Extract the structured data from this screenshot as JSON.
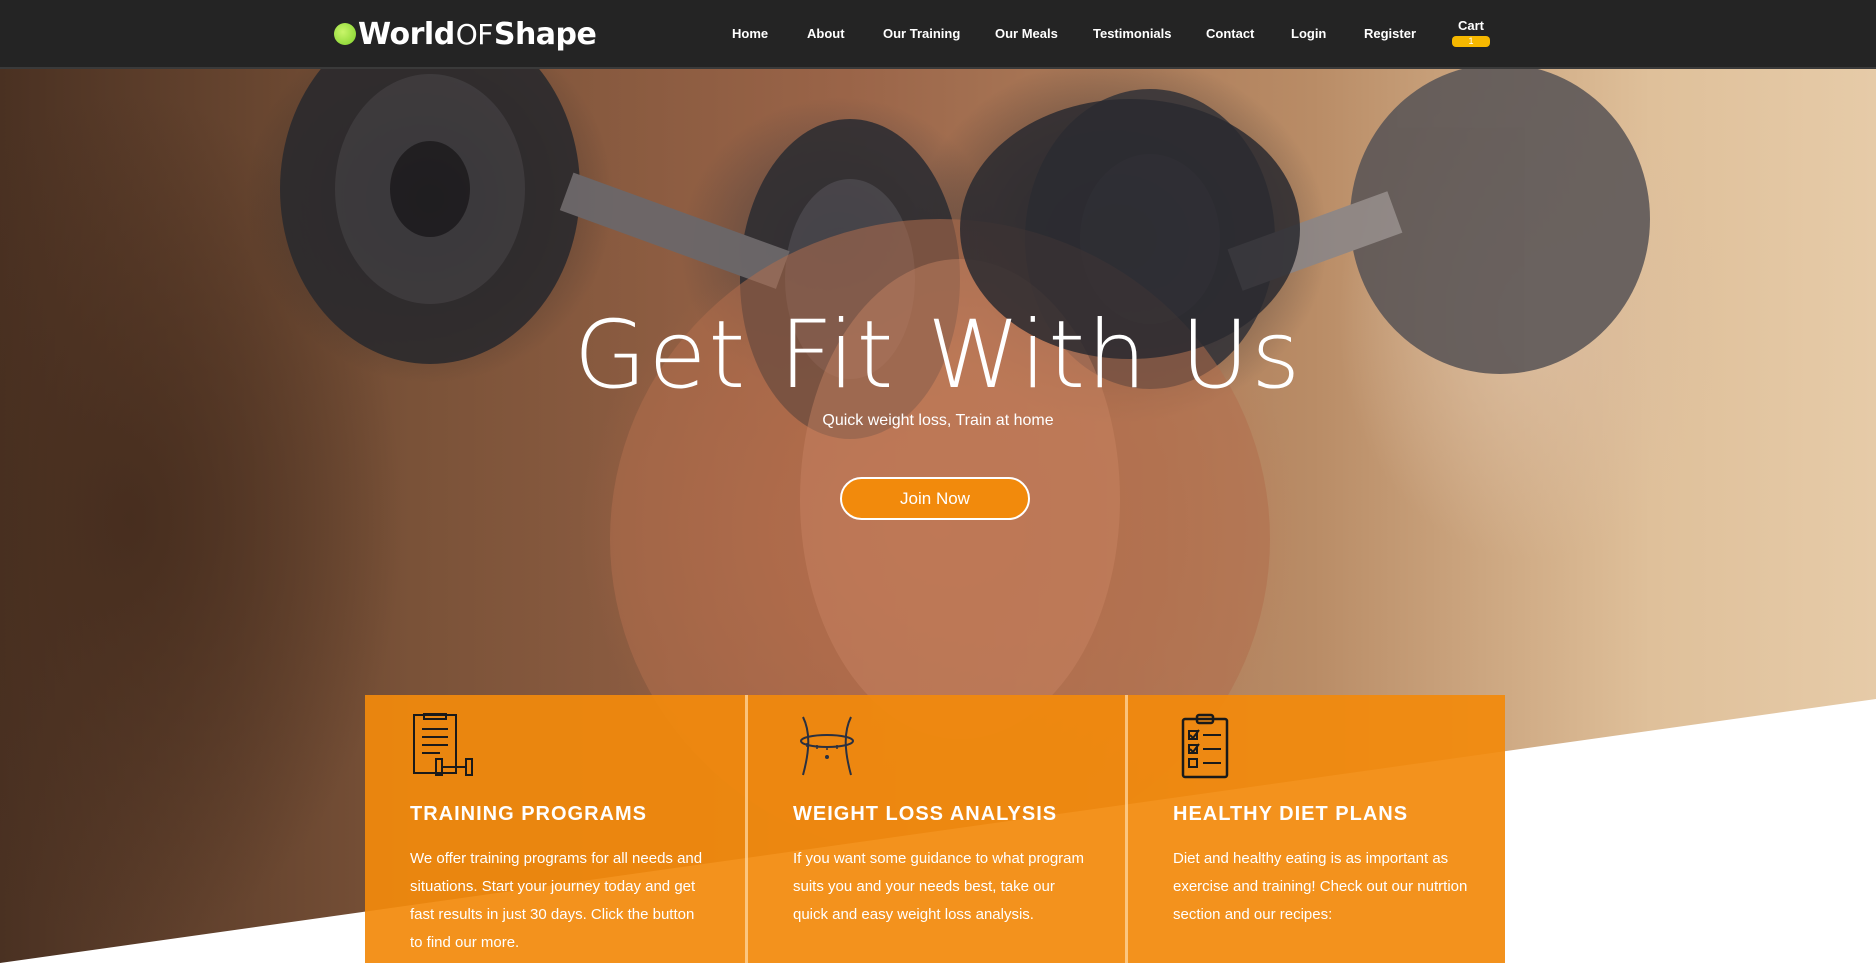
{
  "brand": {
    "name_part1": "World",
    "name_part2": "OF",
    "name_part3": "Shape",
    "accent_color": "#7fd12a"
  },
  "nav": {
    "items": [
      {
        "label": "Home"
      },
      {
        "label": "About"
      },
      {
        "label": "Our Training"
      },
      {
        "label": "Our Meals"
      },
      {
        "label": "Testimonials"
      },
      {
        "label": "Contact"
      },
      {
        "label": "Login"
      },
      {
        "label": "Register"
      }
    ],
    "cart_label": "Cart",
    "cart_count": "1"
  },
  "hero": {
    "title": "Get Fit With Us",
    "subtitle": "Quick weight loss, Train at home",
    "cta_label": "Join Now",
    "cta_color": "#f28a0c"
  },
  "features": [
    {
      "icon": "training-clipboard-dumbbell-icon",
      "title": "TRAINING PROGRAMS",
      "text": "We offer training programs for all needs and situations. Start your journey today and get fast results in just 30 days. Click the button to find our more."
    },
    {
      "icon": "waist-measuring-tape-icon",
      "title": "WEIGHT LOSS ANALYSIS",
      "text": "If you want some guidance to what program suits you and your needs best, take our quick and easy weight loss analysis."
    },
    {
      "icon": "checklist-clipboard-icon",
      "title": "HEALTHY DIET PLANS",
      "text": "Diet and healthy eating is as important as exercise and training! Check out our nutrtion section and our recipes:"
    }
  ]
}
